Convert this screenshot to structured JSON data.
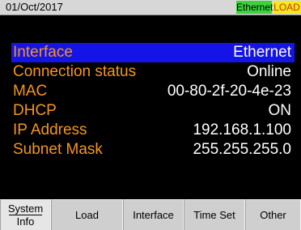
{
  "status_bar": {
    "date": "01/Oct/2017",
    "interface_badge": "Ethernet",
    "mode_badge": "LOAD"
  },
  "params": [
    {
      "label": "Interface",
      "value": "Ethernet",
      "selected": true
    },
    {
      "label": "Connection status",
      "value": "Online",
      "selected": false
    },
    {
      "label": "MAC",
      "value": "00-80-2f-20-4e-23",
      "selected": false
    },
    {
      "label": "DHCP",
      "value": "ON",
      "selected": false
    },
    {
      "label": "IP Address",
      "value": "192.168.1.100",
      "selected": false
    },
    {
      "label": "Subnet Mask",
      "value": "255.255.255.0",
      "selected": false
    }
  ],
  "softkeys": {
    "system_info_top": "System",
    "system_info_bottom": "Info",
    "load": "Load",
    "interface": "Interface",
    "time_set": "Time Set",
    "other": "Other"
  },
  "colors": {
    "label": "#f5961e",
    "value": "#ffffff",
    "selection": "#1414e6",
    "ethernet_badge": "#3bd33b",
    "load_badge": "#f2ea1e"
  }
}
